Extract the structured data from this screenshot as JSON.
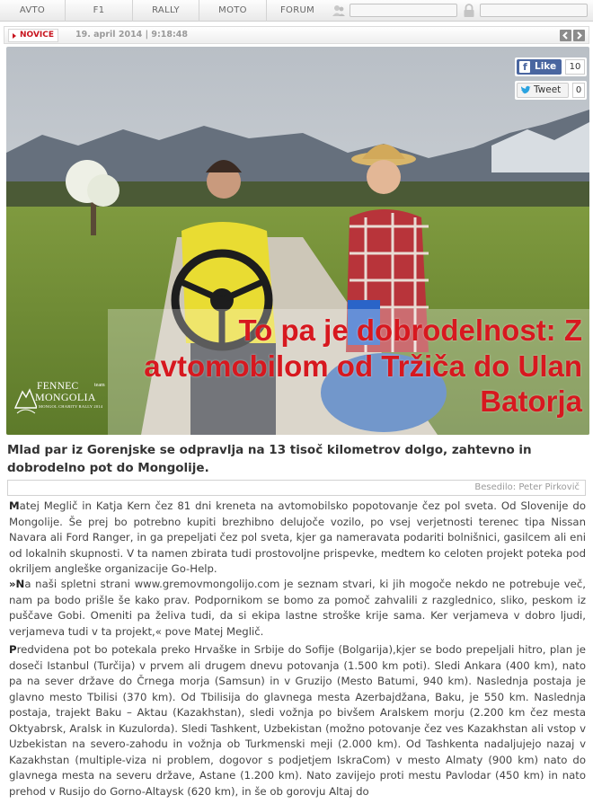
{
  "nav": {
    "items": [
      {
        "label": "AVTO"
      },
      {
        "label": "F1"
      },
      {
        "label": "RALLY"
      },
      {
        "label": "MOTO"
      },
      {
        "label": "FORUM"
      }
    ],
    "user_icon": "user-icon",
    "lock_icon": "lock-icon",
    "username_value": "",
    "password_value": ""
  },
  "meta": {
    "tag": "NOVICE",
    "datetime": "19. april 2014 | 9:18:48",
    "prev_icon": "chevron-left-icon",
    "next_icon": "chevron-right-icon"
  },
  "hero": {
    "headline": "To pa je dobrodelnost: Z avtomobilom od Tržiča do Ulan Batorja",
    "logo": {
      "line1": "FENNEC",
      "team": "team",
      "line2": "MONGOLIA",
      "line3": "MONGOL CHARITY RALLY 2014"
    },
    "facebook": {
      "label": "Like",
      "count": "10",
      "icon": "facebook-icon"
    },
    "twitter": {
      "label": "Tweet",
      "count": "0",
      "icon": "twitter-icon"
    }
  },
  "article": {
    "lead": "Mlad par iz Gorenjske se odpravlja na 13 tisoč kilometrov dolgo, zahtevno in dobrodelno pot do Mongolije.",
    "author": "Besedilo: Peter Pirkovič",
    "paragraphs": [
      {
        "cap": "M",
        "text": "atej Meglič in Katja Kern čez 81 dni kreneta na avtomobilsko popotovanje čez pol sveta. Od Slovenije do Mongolije. Še prej bo potrebno kupiti brezhibno delujoče vozilo, po vsej verjetnosti terenec tipa Nissan Navara ali Ford Ranger, in ga prepeljati čez pol sveta, kjer ga nameravata podariti bolnišnici, gasilcem ali eni od lokalnih skupnosti. V ta namen zbirata tudi prostovoljne prispevke, medtem ko celoten projekt poteka pod okriljem angleške organizacije Go-Help."
      },
      {
        "cap": "»N",
        "text": "a naši spletni strani www.gremovmongolijo.com je seznam stvari, ki jih mogoče nekdo ne potrebuje več, nam pa bodo prišle še kako prav. Podpornikom se bomo za pomoč zahvalili z razglednico, sliko, peskom iz puščave Gobi. Omeniti pa želiva tudi, da si ekipa lastne stroške krije sama. Ker verjameva v dobro ljudi, verjameva tudi v ta projekt,« pove Matej Meglič."
      },
      {
        "cap": "P",
        "text": "redvidena pot bo potekala preko Hrvaške in Srbije do Sofije (Bolgarija),kjer se bodo prepeljali hitro, plan je doseči Istanbul (Turčija) v prvem ali drugem dnevu potovanja (1.500  km poti). Sledi Ankara (400 km), nato pa na sever države do Črnega morja (Samsun) in v Gruzijo (Mesto Batumi, 940 km). Naslednja postaja je glavno mesto Tbilisi (370 km). Od Tbilisija do glavnega mesta Azerbajdžana, Baku, je 550 km. Naslednja postaja, trajekt Baku – Aktau (Kazakhstan), sledi vožnja po bivšem Aralskem morju (2.200 km čez mesta Oktyabrsk, Aralsk in Kuzulorda). Sledi Tashkent, Uzbekistan (možno potovanje čez ves Kazakhstan ali vstop v Uzbekistan na severo-zahodu in vožnja ob Turkmenski meji (2.000 km). Od Tashkenta nadaljujejo nazaj v Kazakhstan (multiple-viza ni problem, dogovor s podjetjem IskraCom) v mesto Almaty (900 km) nato do glavnega mesta na severu države, Astane (1.200 km). Nato zavijejo proti mestu Pavlodar (450 km) in nato prehod v Rusijo do Gorno-Altaysk (620 km), in še ob gorovju Altaj do"
      }
    ]
  },
  "colors": {
    "accent": "#d7181f",
    "facebook": "#4a66a0"
  }
}
